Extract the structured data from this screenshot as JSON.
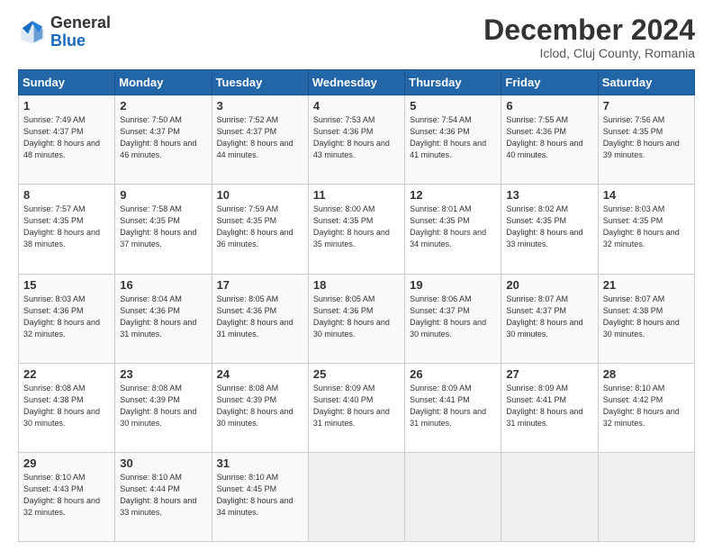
{
  "header": {
    "logo_line1": "General",
    "logo_line2": "Blue",
    "month": "December 2024",
    "location": "Iclod, Cluj County, Romania"
  },
  "weekdays": [
    "Sunday",
    "Monday",
    "Tuesday",
    "Wednesday",
    "Thursday",
    "Friday",
    "Saturday"
  ],
  "weeks": [
    [
      {
        "day": "1",
        "info": "Sunrise: 7:49 AM\nSunset: 4:37 PM\nDaylight: 8 hours\nand 48 minutes."
      },
      {
        "day": "2",
        "info": "Sunrise: 7:50 AM\nSunset: 4:37 PM\nDaylight: 8 hours\nand 46 minutes."
      },
      {
        "day": "3",
        "info": "Sunrise: 7:52 AM\nSunset: 4:37 PM\nDaylight: 8 hours\nand 44 minutes."
      },
      {
        "day": "4",
        "info": "Sunrise: 7:53 AM\nSunset: 4:36 PM\nDaylight: 8 hours\nand 43 minutes."
      },
      {
        "day": "5",
        "info": "Sunrise: 7:54 AM\nSunset: 4:36 PM\nDaylight: 8 hours\nand 41 minutes."
      },
      {
        "day": "6",
        "info": "Sunrise: 7:55 AM\nSunset: 4:36 PM\nDaylight: 8 hours\nand 40 minutes."
      },
      {
        "day": "7",
        "info": "Sunrise: 7:56 AM\nSunset: 4:35 PM\nDaylight: 8 hours\nand 39 minutes."
      }
    ],
    [
      {
        "day": "8",
        "info": "Sunrise: 7:57 AM\nSunset: 4:35 PM\nDaylight: 8 hours\nand 38 minutes."
      },
      {
        "day": "9",
        "info": "Sunrise: 7:58 AM\nSunset: 4:35 PM\nDaylight: 8 hours\nand 37 minutes."
      },
      {
        "day": "10",
        "info": "Sunrise: 7:59 AM\nSunset: 4:35 PM\nDaylight: 8 hours\nand 36 minutes."
      },
      {
        "day": "11",
        "info": "Sunrise: 8:00 AM\nSunset: 4:35 PM\nDaylight: 8 hours\nand 35 minutes."
      },
      {
        "day": "12",
        "info": "Sunrise: 8:01 AM\nSunset: 4:35 PM\nDaylight: 8 hours\nand 34 minutes."
      },
      {
        "day": "13",
        "info": "Sunrise: 8:02 AM\nSunset: 4:35 PM\nDaylight: 8 hours\nand 33 minutes."
      },
      {
        "day": "14",
        "info": "Sunrise: 8:03 AM\nSunset: 4:35 PM\nDaylight: 8 hours\nand 32 minutes."
      }
    ],
    [
      {
        "day": "15",
        "info": "Sunrise: 8:03 AM\nSunset: 4:36 PM\nDaylight: 8 hours\nand 32 minutes."
      },
      {
        "day": "16",
        "info": "Sunrise: 8:04 AM\nSunset: 4:36 PM\nDaylight: 8 hours\nand 31 minutes."
      },
      {
        "day": "17",
        "info": "Sunrise: 8:05 AM\nSunset: 4:36 PM\nDaylight: 8 hours\nand 31 minutes."
      },
      {
        "day": "18",
        "info": "Sunrise: 8:05 AM\nSunset: 4:36 PM\nDaylight: 8 hours\nand 30 minutes."
      },
      {
        "day": "19",
        "info": "Sunrise: 8:06 AM\nSunset: 4:37 PM\nDaylight: 8 hours\nand 30 minutes."
      },
      {
        "day": "20",
        "info": "Sunrise: 8:07 AM\nSunset: 4:37 PM\nDaylight: 8 hours\nand 30 minutes."
      },
      {
        "day": "21",
        "info": "Sunrise: 8:07 AM\nSunset: 4:38 PM\nDaylight: 8 hours\nand 30 minutes."
      }
    ],
    [
      {
        "day": "22",
        "info": "Sunrise: 8:08 AM\nSunset: 4:38 PM\nDaylight: 8 hours\nand 30 minutes."
      },
      {
        "day": "23",
        "info": "Sunrise: 8:08 AM\nSunset: 4:39 PM\nDaylight: 8 hours\nand 30 minutes."
      },
      {
        "day": "24",
        "info": "Sunrise: 8:08 AM\nSunset: 4:39 PM\nDaylight: 8 hours\nand 30 minutes."
      },
      {
        "day": "25",
        "info": "Sunrise: 8:09 AM\nSunset: 4:40 PM\nDaylight: 8 hours\nand 31 minutes."
      },
      {
        "day": "26",
        "info": "Sunrise: 8:09 AM\nSunset: 4:41 PM\nDaylight: 8 hours\nand 31 minutes."
      },
      {
        "day": "27",
        "info": "Sunrise: 8:09 AM\nSunset: 4:41 PM\nDaylight: 8 hours\nand 31 minutes."
      },
      {
        "day": "28",
        "info": "Sunrise: 8:10 AM\nSunset: 4:42 PM\nDaylight: 8 hours\nand 32 minutes."
      }
    ],
    [
      {
        "day": "29",
        "info": "Sunrise: 8:10 AM\nSunset: 4:43 PM\nDaylight: 8 hours\nand 32 minutes."
      },
      {
        "day": "30",
        "info": "Sunrise: 8:10 AM\nSunset: 4:44 PM\nDaylight: 8 hours\nand 33 minutes."
      },
      {
        "day": "31",
        "info": "Sunrise: 8:10 AM\nSunset: 4:45 PM\nDaylight: 8 hours\nand 34 minutes."
      },
      {
        "day": "",
        "info": ""
      },
      {
        "day": "",
        "info": ""
      },
      {
        "day": "",
        "info": ""
      },
      {
        "day": "",
        "info": ""
      }
    ]
  ]
}
